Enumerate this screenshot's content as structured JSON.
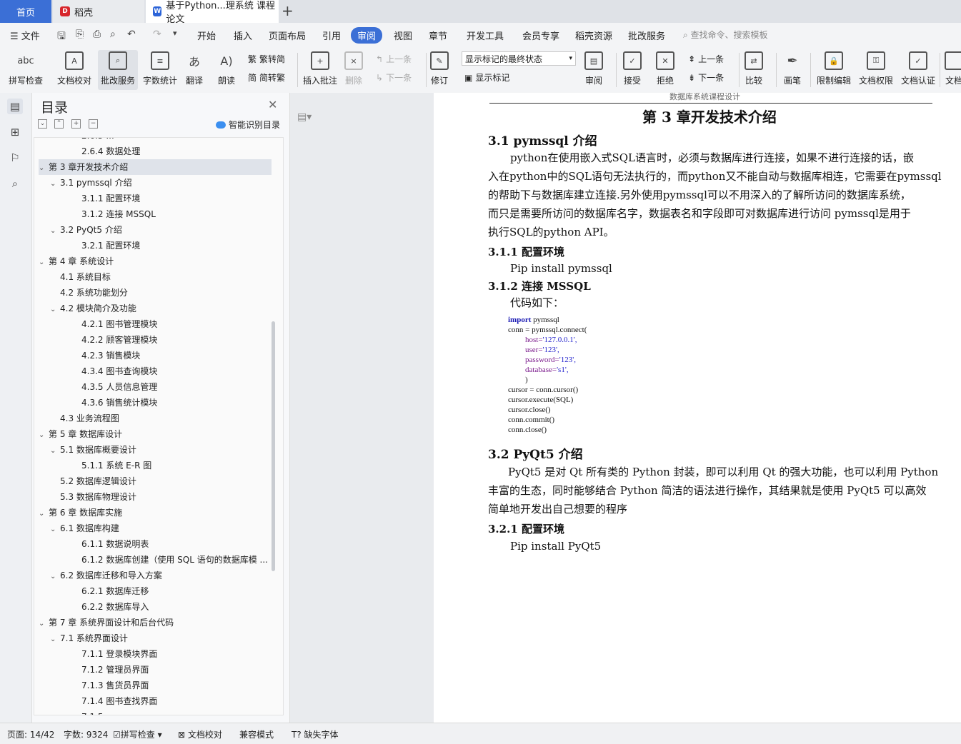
{
  "tabs": {
    "home": "首页",
    "docer": "稻壳",
    "doc": "基于Python...理系统 课程论文",
    "add": "+"
  },
  "menu": {
    "file": "文件",
    "items": [
      "开始",
      "插入",
      "页面布局",
      "引用",
      "审阅",
      "视图",
      "章节",
      "开发工具",
      "会员专享",
      "稻壳资源",
      "批改服务"
    ],
    "search": "查找命令、搜索模板"
  },
  "ribbon": {
    "spell": "拼写检查",
    "proof": "文档校对",
    "grading": "批改服务",
    "wordcount": "字数统计",
    "translate": "翻译",
    "read": "朗读",
    "to_trad": "繁转简",
    "to_simp": "简转繁",
    "insert_comment": "插入批注",
    "delete": "删除",
    "prev": "上一条",
    "next": "下一条",
    "revise": "修订",
    "markup_state": "显示标记的最终状态",
    "show_markup": "显示标记",
    "review": "审阅",
    "accept": "接受",
    "reject": "拒绝",
    "prev2": "上一条",
    "next2": "下一条",
    "compare": "比较",
    "pen": "画笔",
    "restrict": "限制编辑",
    "rights": "文档权限",
    "certify": "文档认证",
    "more": "文档"
  },
  "toc": {
    "title": "目录",
    "smart": "智能识别目录",
    "items": [
      {
        "label": "2.6.3 ...",
        "level": 3,
        "arrow": false
      },
      {
        "label": "2.6.4  数据处理",
        "level": 3,
        "arrow": false
      },
      {
        "label": "第 3 章开发技术介绍",
        "level": 1,
        "arrow": true,
        "selected": true
      },
      {
        "label": "3.1 pymssql 介绍",
        "level": 2,
        "arrow": true
      },
      {
        "label": "3.1.1  配置环境",
        "level": 3,
        "arrow": false
      },
      {
        "label": "3.1.2  连接 MSSQL",
        "level": 3,
        "arrow": false
      },
      {
        "label": "3.2 PyQt5 介绍",
        "level": 2,
        "arrow": true
      },
      {
        "label": "3.2.1  配置环境",
        "level": 3,
        "arrow": false
      },
      {
        "label": "第 4 章  系统设计",
        "level": 1,
        "arrow": true
      },
      {
        "label": "4.1  系统目标",
        "level": 2,
        "arrow": false
      },
      {
        "label": "4.2  系统功能划分",
        "level": 2,
        "arrow": false
      },
      {
        "label": "4.2  模块简介及功能",
        "level": 2,
        "arrow": true
      },
      {
        "label": "4.2.1  图书管理模块",
        "level": 3,
        "arrow": false
      },
      {
        "label": "4.2.2  顾客管理模块",
        "level": 3,
        "arrow": false
      },
      {
        "label": "4.2.3  销售模块",
        "level": 3,
        "arrow": false
      },
      {
        "label": "4.3.4  图书查询模块",
        "level": 3,
        "arrow": false
      },
      {
        "label": "4.3.5  人员信息管理",
        "level": 3,
        "arrow": false
      },
      {
        "label": "4.3.6  销售统计模块",
        "level": 3,
        "arrow": false
      },
      {
        "label": "4.3  业务流程图",
        "level": 2,
        "arrow": false
      },
      {
        "label": "第 5 章  数据库设计",
        "level": 1,
        "arrow": true
      },
      {
        "label": "5.1  数据库概要设计",
        "level": 2,
        "arrow": true
      },
      {
        "label": "5.1.1 系统 E-R 图",
        "level": 3,
        "arrow": false
      },
      {
        "label": "5.2 数据库逻辑设计",
        "level": 2,
        "arrow": false
      },
      {
        "label": "5.3  数据库物理设计",
        "level": 2,
        "arrow": false
      },
      {
        "label": "第 6 章  数据库实施",
        "level": 1,
        "arrow": true
      },
      {
        "label": "6.1  数据库构建",
        "level": 2,
        "arrow": true
      },
      {
        "label": "6.1.1  数据说明表",
        "level": 3,
        "arrow": false
      },
      {
        "label": "6.1.2  数据库创建（使用 SQL 语句的数据库模 ...",
        "level": 3,
        "arrow": false
      },
      {
        "label": "6.2  数据库迁移和导入方案",
        "level": 2,
        "arrow": true
      },
      {
        "label": "6.2.1 数据库迁移",
        "level": 3,
        "arrow": false
      },
      {
        "label": "6.2.2 数据库导入",
        "level": 3,
        "arrow": false
      },
      {
        "label": "第 7 章  系统界面设计和后台代码",
        "level": 1,
        "arrow": true
      },
      {
        "label": "7.1  系统界面设计",
        "level": 2,
        "arrow": true
      },
      {
        "label": "7.1.1  登录模块界面",
        "level": 3,
        "arrow": false
      },
      {
        "label": "7.1.2  管理员界面",
        "level": 3,
        "arrow": false
      },
      {
        "label": "7.1.3 售货员界面",
        "level": 3,
        "arrow": false
      },
      {
        "label": "7.1.4 图书查找界面",
        "level": 3,
        "arrow": false
      },
      {
        "label": "7.1.5 ...",
        "level": 3,
        "arrow": false
      }
    ]
  },
  "doc": {
    "header": "数据库系统课程设计",
    "chapter": "第 3 章开发技术介绍",
    "s31": "3.1 pymssql 介绍",
    "p1": [
      "python在使用嵌入式SQL语言时，必须与数据库进行连接，如果不进行连接的话，嵌",
      "入在python中的SQL语句无法执行的，而python又不能自动与数据库相连，它需要在pymssql",
      "的帮助下与数据库建立连接.另外使用pymssql可以不用深入的了解所访问的数据库系统，",
      "而只是需要所访问的数据库名字，数据表名和字段即可对数据库进行访问  pymssql是用于",
      "执行SQL的python API。"
    ],
    "s311": "3.1.1  配置环境",
    "pip1": "Pip install pymssql",
    "s312": "3.1.2  连接 MSSQL",
    "code_intro": "代码如下：",
    "code": {
      "import_kw": "import",
      "import_mod": " pymssql",
      "conn": "conn = pymssql.connect(",
      "host_k": "host=",
      "host_v": "'127.0.0.1',",
      "user_k": "user=",
      "user_v": "'123',",
      "pw_k": "password=",
      "pw_v": "'123',",
      "db_k": "database=",
      "db_v": "'s1',",
      "close_paren": ")",
      "l1": "cursor = conn.cursor()",
      "l2": "cursor.execute(SQL)",
      "l3": "cursor.close()",
      "l4": "conn.commit()",
      "l5": "conn.close()"
    },
    "s32": "3.2 PyQt5 介绍",
    "p2": [
      "PyQt5 是对 Qt 所有类的 Python 封装，即可以利用 Qt 的强大功能，也可以利用 Python",
      "丰富的生态，同时能够结合 Python 简洁的语法进行操作，其结果就是使用 PyQt5 可以高效",
      "简单地开发出自己想要的程序"
    ],
    "s321": "3.2.1  配置环境",
    "pip2": "Pip install PyQt5"
  },
  "status": {
    "page": "页面: 14/42",
    "words": "字数: 9324",
    "spell": "拼写检查",
    "proof": "文档校对",
    "compat": "兼容模式",
    "fonts": "缺失字体"
  }
}
